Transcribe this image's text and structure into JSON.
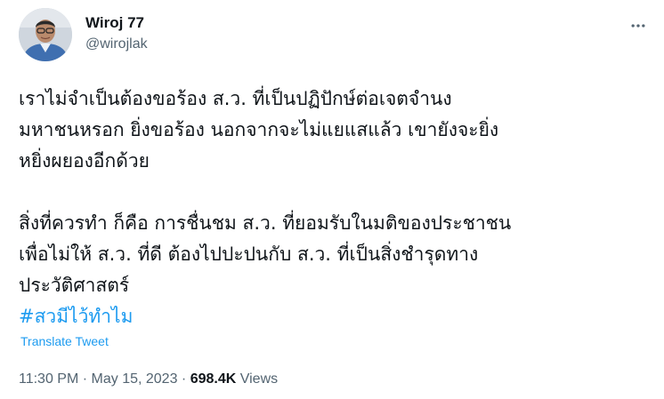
{
  "author": {
    "name": "Wiroj 77",
    "handle": "@wirojlak",
    "avatar_icon": "profile-photo"
  },
  "more_icon": "more-horizontal-icon",
  "tweet": {
    "lines_p1": [
      "เราไม่จำเป็นต้องขอร้อง ส.ว. ที่เป็นปฏิปักษ์ต่อเจตจำนง",
      "มหาชนหรอก ยิ่งขอร้อง นอกจากจะไม่แยแสแล้ว เขายังจะยิ่ง",
      "หยิ่งผยองอีกด้วย"
    ],
    "lines_p2": [
      "สิ่งที่ควรทำ ก็คือ การชื่นชม ส.ว. ที่ยอมรับในมติของประชาชน",
      "เพื่อไม่ให้ ส.ว. ที่ดี ต้องไปปะปนกับ ส.ว. ที่เป็นสิ่งชำรุดทาง",
      "ประวัติศาสตร์"
    ],
    "hashtag": "#สวมีไว้ทำไม"
  },
  "translate_label": "Translate Tweet",
  "meta": {
    "time": "11:30 PM",
    "sep1": " · ",
    "date": "May 15, 2023",
    "sep2": " · ",
    "views_count": "698.4K",
    "views_label": " Views"
  },
  "colors": {
    "link": "#1d9bf0",
    "text": "#0f1419",
    "secondary": "#536471"
  }
}
